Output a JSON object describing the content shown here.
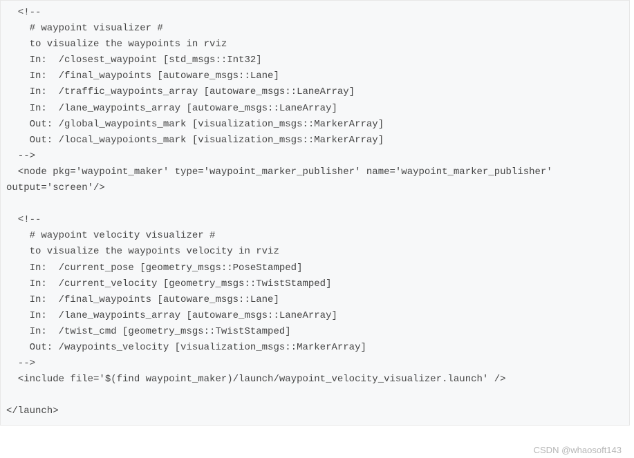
{
  "code": {
    "l01": "  <!--",
    "l02": "    # waypoint visualizer #",
    "l03": "    to visualize the waypoints in rviz",
    "l04": "    In:  /closest_waypoint [std_msgs::Int32]",
    "l05": "    In:  /final_waypoints [autoware_msgs::Lane]",
    "l06": "    In:  /traffic_waypoints_array [autoware_msgs::LaneArray]",
    "l07": "    In:  /lane_waypoints_array [autoware_msgs::LaneArray]",
    "l08": "    Out: /global_waypoints_mark [visualization_msgs::MarkerArray]",
    "l09": "    Out: /local_waypoionts_mark [visualization_msgs::MarkerArray]",
    "l10": "  -->",
    "l11": "  <node pkg='waypoint_maker' type='waypoint_marker_publisher' name='waypoint_marker_publisher'",
    "l12": "output='screen'/>",
    "l13": "",
    "l14": "  <!--",
    "l15": "    # waypoint velocity visualizer #",
    "l16": "    to visualize the waypoints velocity in rviz",
    "l17": "    In:  /current_pose [geometry_msgs::PoseStamped]",
    "l18": "    In:  /current_velocity [geometry_msgs::TwistStamped]",
    "l19": "    In:  /final_waypoints [autoware_msgs::Lane]",
    "l20": "    In:  /lane_waypoints_array [autoware_msgs::LaneArray]",
    "l21": "    In:  /twist_cmd [geometry_msgs::TwistStamped]",
    "l22": "    Out: /waypoints_velocity [visualization_msgs::MarkerArray]",
    "l23": "  -->",
    "l24": "  <include file='$(find waypoint_maker)/launch/waypoint_velocity_visualizer.launch' />",
    "l25": "",
    "l26": "</launch>"
  },
  "watermark": "CSDN @whaosoft143"
}
